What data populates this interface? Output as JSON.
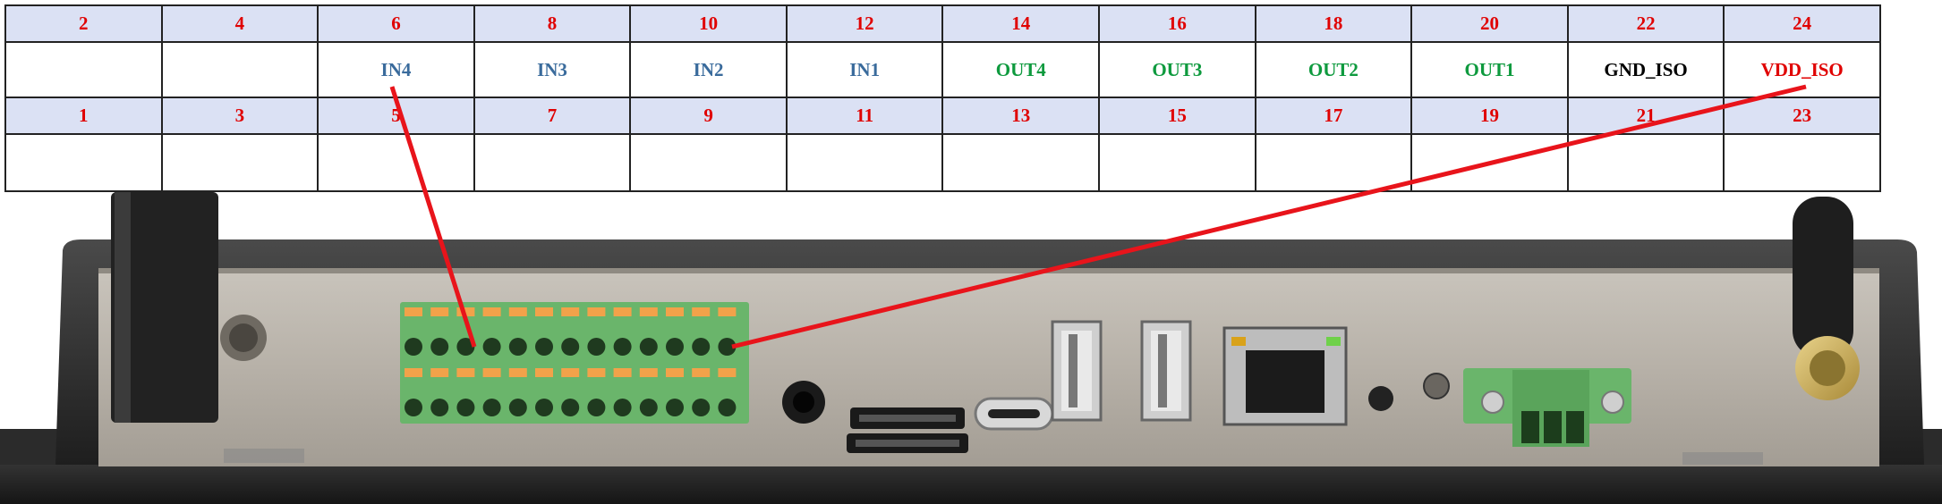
{
  "pin_table": {
    "top_numbers": [
      "2",
      "4",
      "6",
      "8",
      "10",
      "12",
      "14",
      "16",
      "18",
      "20",
      "22",
      "24"
    ],
    "top_signals": [
      {
        "text": "",
        "type": "none"
      },
      {
        "text": "",
        "type": "none"
      },
      {
        "text": "IN4",
        "type": "in"
      },
      {
        "text": "IN3",
        "type": "in"
      },
      {
        "text": "IN2",
        "type": "in"
      },
      {
        "text": "IN1",
        "type": "in"
      },
      {
        "text": "OUT4",
        "type": "out"
      },
      {
        "text": "OUT3",
        "type": "out"
      },
      {
        "text": "OUT2",
        "type": "out"
      },
      {
        "text": "OUT1",
        "type": "out"
      },
      {
        "text": "GND_ISO",
        "type": "gnd"
      },
      {
        "text": "VDD_ISO",
        "type": "vdd"
      }
    ],
    "bottom_numbers": [
      "1",
      "3",
      "5",
      "7",
      "9",
      "11",
      "13",
      "15",
      "17",
      "19",
      "21",
      "23"
    ],
    "bottom_signals": [
      "",
      "",
      "",
      "",
      "",
      "",
      "",
      "",
      "",
      "",
      "",
      ""
    ]
  },
  "colors": {
    "header_bg": "#dbe1f4",
    "pin_number": "#e00000",
    "input_signal": "#3a6b9c",
    "output_signal": "#0e9a3e",
    "ground_signal": "#000000",
    "supply_signal": "#e00000",
    "pointer_line": "#e8141b",
    "terminal_green": "#7dc67a",
    "terminal_orange": "#f2a24a"
  },
  "device_ports": [
    "antenna-left",
    "terminal-block-24pin",
    "audio-jack",
    "sd-card-slot",
    "sim-card-slot",
    "usb-c-port",
    "usb-a-port-1",
    "usb-a-port-2",
    "ethernet-port",
    "led-indicator",
    "power-button",
    "power-connector-3pin",
    "antenna-right"
  ]
}
